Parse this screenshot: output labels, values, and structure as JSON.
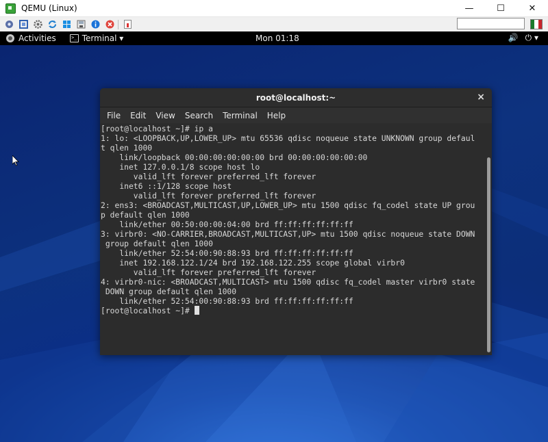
{
  "window": {
    "title": "QEMU (Linux)",
    "minimize": "—",
    "maximize": "☐",
    "close": "✕"
  },
  "toolbar": {
    "search_value": "",
    "icons": [
      "settings-icon",
      "fullscreen-icon",
      "gear-icon",
      "refresh-icon",
      "windows-icon",
      "disk-icon",
      "info-icon",
      "stop-icon",
      "screenshot-icon"
    ]
  },
  "gnome": {
    "activities": "Activities",
    "app_menu": "Terminal ▾",
    "clock": "Mon 01:18",
    "volume": "🔊",
    "power": "⏻ ▾"
  },
  "terminal": {
    "title": "root@localhost:~",
    "close": "×",
    "menu": [
      "File",
      "Edit",
      "View",
      "Search",
      "Terminal",
      "Help"
    ],
    "lines": [
      "[root@localhost ~]# ip a",
      "1: lo: <LOOPBACK,UP,LOWER_UP> mtu 65536 qdisc noqueue state UNKNOWN group defaul",
      "t qlen 1000",
      "    link/loopback 00:00:00:00:00:00 brd 00:00:00:00:00:00",
      "    inet 127.0.0.1/8 scope host lo",
      "       valid_lft forever preferred_lft forever",
      "    inet6 ::1/128 scope host",
      "       valid_lft forever preferred_lft forever",
      "2: ens3: <BROADCAST,MULTICAST,UP,LOWER_UP> mtu 1500 qdisc fq_codel state UP grou",
      "p default qlen 1000",
      "    link/ether 00:50:00:00:04:00 brd ff:ff:ff:ff:ff:ff",
      "3: virbr0: <NO-CARRIER,BROADCAST,MULTICAST,UP> mtu 1500 qdisc noqueue state DOWN",
      " group default qlen 1000",
      "    link/ether 52:54:00:90:88:93 brd ff:ff:ff:ff:ff:ff",
      "    inet 192.168.122.1/24 brd 192.168.122.255 scope global virbr0",
      "       valid_lft forever preferred_lft forever",
      "4: virbr0-nic: <BROADCAST,MULTICAST> mtu 1500 qdisc fq_codel master virbr0 state",
      " DOWN group default qlen 1000",
      "    link/ether 52:54:00:90:88:93 brd ff:ff:ff:ff:ff:ff"
    ],
    "prompt": "[root@localhost ~]# "
  },
  "colors": {
    "terminal_bg": "#2c2c2c",
    "terminal_fg": "#d8d8d8",
    "topbar": "#000000",
    "desktop_accent": "#1e5bc6"
  }
}
